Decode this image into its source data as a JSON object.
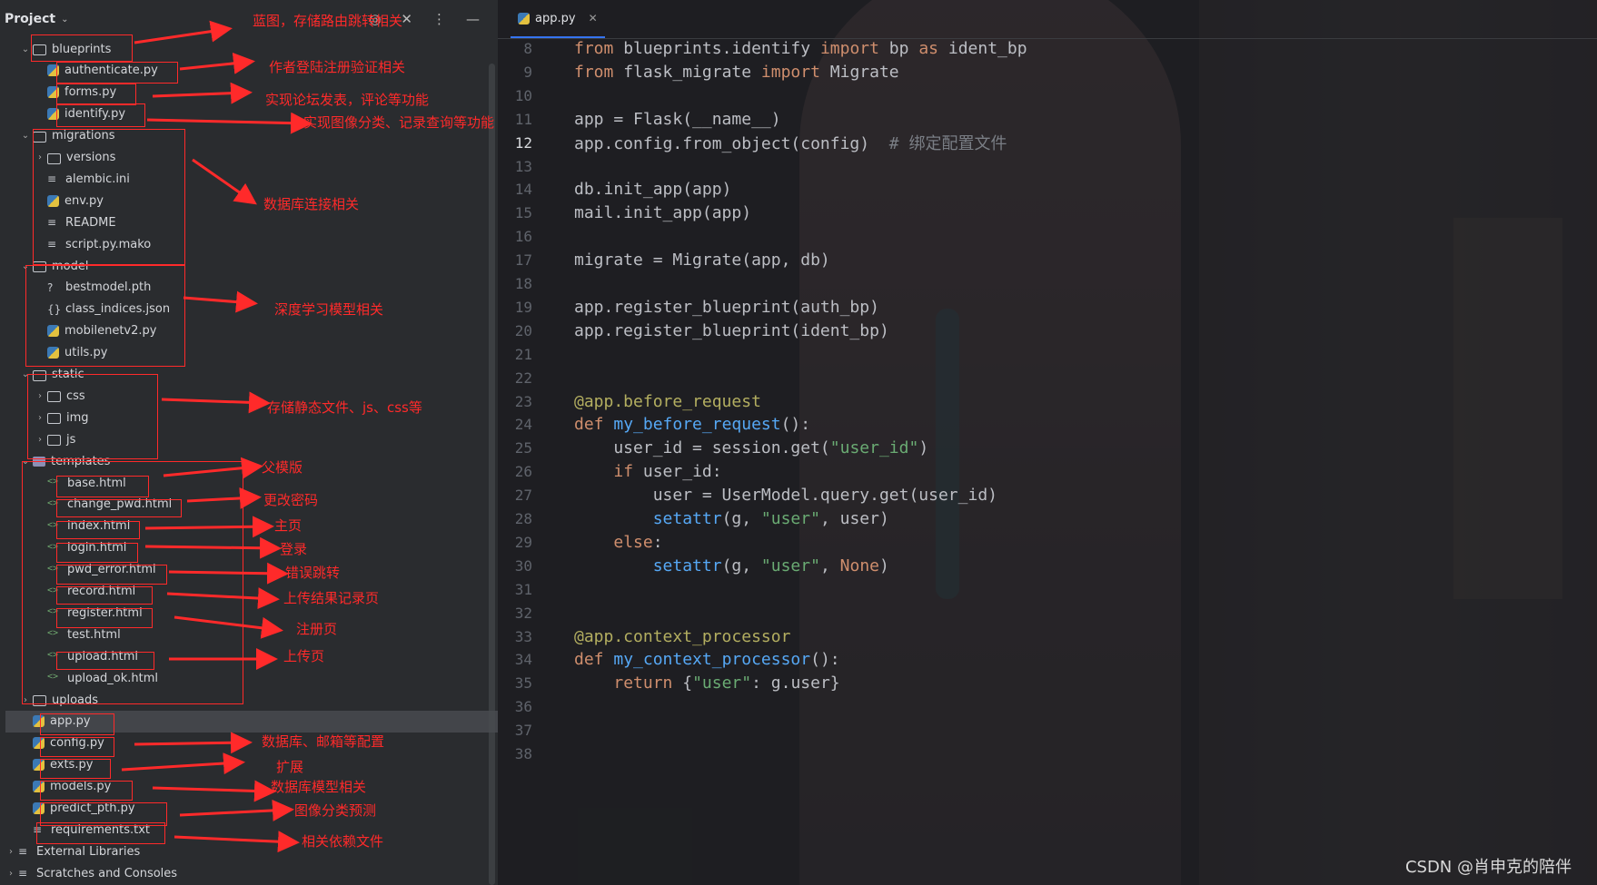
{
  "project": {
    "title": "Project",
    "tree": [
      {
        "label": "blueprints",
        "type": "folder",
        "depth": 1,
        "expanded": true
      },
      {
        "label": "authenticate.py",
        "type": "py",
        "depth": 2
      },
      {
        "label": "forms.py",
        "type": "py",
        "depth": 2
      },
      {
        "label": "identify.py",
        "type": "py",
        "depth": 2
      },
      {
        "label": "migrations",
        "type": "folder",
        "depth": 1,
        "expanded": true
      },
      {
        "label": "versions",
        "type": "folder",
        "depth": 2,
        "expanded": false
      },
      {
        "label": "alembic.ini",
        "type": "txt",
        "depth": 2
      },
      {
        "label": "env.py",
        "type": "py",
        "depth": 2
      },
      {
        "label": "README",
        "type": "txt",
        "depth": 2
      },
      {
        "label": "script.py.mako",
        "type": "txt",
        "depth": 2
      },
      {
        "label": "model",
        "type": "folder",
        "depth": 1,
        "expanded": true
      },
      {
        "label": "bestmodel.pth",
        "type": "unknown",
        "depth": 2
      },
      {
        "label": "class_indices.json",
        "type": "json",
        "depth": 2
      },
      {
        "label": "mobilenetv2.py",
        "type": "py",
        "depth": 2
      },
      {
        "label": "utils.py",
        "type": "py",
        "depth": 2
      },
      {
        "label": "static",
        "type": "folder",
        "depth": 1,
        "expanded": true
      },
      {
        "label": "css",
        "type": "folder",
        "depth": 2,
        "expanded": false
      },
      {
        "label": "img",
        "type": "folder",
        "depth": 2,
        "expanded": false
      },
      {
        "label": "js",
        "type": "folder",
        "depth": 2,
        "expanded": false
      },
      {
        "label": "templates",
        "type": "folder-tpl",
        "depth": 1,
        "expanded": true
      },
      {
        "label": "base.html",
        "type": "html",
        "depth": 2
      },
      {
        "label": "change_pwd.html",
        "type": "html",
        "depth": 2
      },
      {
        "label": "index.html",
        "type": "html",
        "depth": 2
      },
      {
        "label": "login.html",
        "type": "html",
        "depth": 2
      },
      {
        "label": "pwd_error.html",
        "type": "html",
        "depth": 2
      },
      {
        "label": "record.html",
        "type": "html",
        "depth": 2
      },
      {
        "label": "register.html",
        "type": "html",
        "depth": 2
      },
      {
        "label": "test.html",
        "type": "html",
        "depth": 2
      },
      {
        "label": "upload.html",
        "type": "html",
        "depth": 2
      },
      {
        "label": "upload_ok.html",
        "type": "html",
        "depth": 2
      },
      {
        "label": "uploads",
        "type": "folder",
        "depth": 1,
        "expanded": false
      },
      {
        "label": "app.py",
        "type": "py",
        "depth": 1,
        "selected": true
      },
      {
        "label": "config.py",
        "type": "py",
        "depth": 1
      },
      {
        "label": "exts.py",
        "type": "py",
        "depth": 1
      },
      {
        "label": "models.py",
        "type": "py",
        "depth": 1
      },
      {
        "label": "predict_pth.py",
        "type": "py",
        "depth": 1
      },
      {
        "label": "requirements.txt",
        "type": "txt",
        "depth": 1
      },
      {
        "label": "External Libraries",
        "type": "lib",
        "depth": 0,
        "expanded": false
      },
      {
        "label": "Scratches and Consoles",
        "type": "scratch",
        "depth": 0,
        "expanded": false
      }
    ]
  },
  "annotations": [
    "蓝图，存储路由跳转相关",
    "作者登陆注册验证相关",
    "实现论坛发表，评论等功能",
    "实现图像分类、记录查询等功能",
    "数据库连接相关",
    "深度学习模型相关",
    "存储静态文件、js、css等",
    "父模版",
    "更改密码",
    "主页",
    "登录",
    "错误跳转",
    "上传结果记录页",
    "注册页",
    "上传页",
    "数据库、邮箱等配置",
    "扩展",
    "数据库模型相关",
    "图像分类预测",
    "相关依赖文件"
  ],
  "editor": {
    "tab_label": "app.py",
    "current_line": 12,
    "lines": [
      {
        "n": 8,
        "html": "<span class='kw'>from</span> blueprints.identify <span class='kw'>import</span> bp <span class='kw'>as</span> ident_bp"
      },
      {
        "n": 9,
        "html": "<span class='kw'>from</span> flask_migrate <span class='kw'>import</span> Migrate"
      },
      {
        "n": 10,
        "html": ""
      },
      {
        "n": 11,
        "html": "app = Flask(__name__)"
      },
      {
        "n": 12,
        "html": "app.config.from_object(config)  <span class='cm'># 绑定配置文件</span>"
      },
      {
        "n": 13,
        "html": ""
      },
      {
        "n": 14,
        "html": "db.init_app(app)"
      },
      {
        "n": 15,
        "html": "mail.init_app(app)"
      },
      {
        "n": 16,
        "html": ""
      },
      {
        "n": 17,
        "html": "migrate = Migrate(app, db)"
      },
      {
        "n": 18,
        "html": ""
      },
      {
        "n": 19,
        "html": "app.register_blueprint(auth_bp)"
      },
      {
        "n": 20,
        "html": "app.register_blueprint(ident_bp)"
      },
      {
        "n": 21,
        "html": ""
      },
      {
        "n": 22,
        "html": ""
      },
      {
        "n": 23,
        "html": "<span class='deco'>@app.before_request</span>"
      },
      {
        "n": 24,
        "html": "<span class='kw'>def</span> <span class='fn'>my_before_request</span>():"
      },
      {
        "n": 25,
        "html": "    user_id = session.get(<span class='str'>\"user_id\"</span>)"
      },
      {
        "n": 26,
        "html": "    <span class='kw'>if</span> user_id:"
      },
      {
        "n": 27,
        "html": "        user = UserModel.query.get(user_id)"
      },
      {
        "n": 28,
        "html": "        <span class='fn'>setattr</span>(g, <span class='str'>\"user\"</span>, user)"
      },
      {
        "n": 29,
        "html": "    <span class='kw'>else</span>:"
      },
      {
        "n": 30,
        "html": "        <span class='fn'>setattr</span>(g, <span class='str'>\"user\"</span>, <span class='kw'>None</span>)"
      },
      {
        "n": 31,
        "html": ""
      },
      {
        "n": 32,
        "html": ""
      },
      {
        "n": 33,
        "html": "<span class='deco'>@app.context_processor</span>"
      },
      {
        "n": 34,
        "html": "<span class='kw'>def</span> <span class='fn'>my_context_processor</span>():"
      },
      {
        "n": 35,
        "html": "    <span class='kw'>return</span> {<span class='str'>\"user\"</span>: g.user}"
      },
      {
        "n": 36,
        "html": ""
      },
      {
        "n": 37,
        "html": ""
      },
      {
        "n": 38,
        "html": ""
      }
    ]
  },
  "watermark": "CSDN @肖申克的陪伴",
  "colors": {
    "accent": "#3574f0",
    "annotation": "#ff2a2a",
    "keyword": "#cf8e6d",
    "function": "#56a8f5",
    "string": "#6aab73"
  }
}
